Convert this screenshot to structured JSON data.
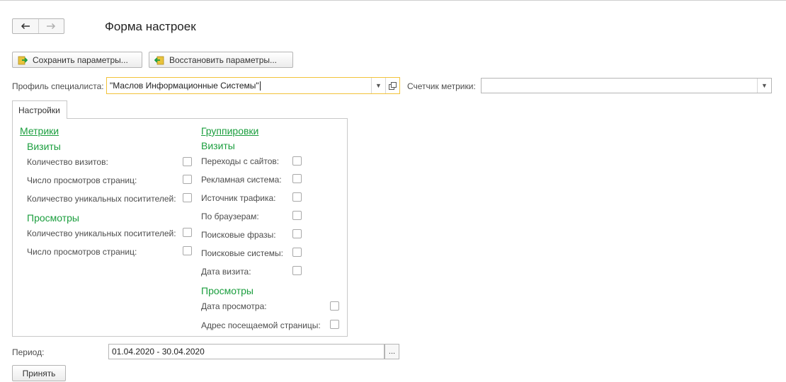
{
  "window": {
    "title": "Форма настроек"
  },
  "nav": {
    "back_icon": "arrow-left-icon",
    "forward_icon": "arrow-right-icon"
  },
  "toolbar": {
    "save_label": "Сохранить параметры...",
    "restore_label": "Восстановить параметры..."
  },
  "profile": {
    "label": "Профиль специалиста:",
    "value": "\"Маслов Информационные Системы\""
  },
  "counter": {
    "label": "Счетчик метрики:",
    "value": ""
  },
  "tabs": {
    "settings_label": "Настройки"
  },
  "metrics": {
    "title": "Метрики",
    "visits": {
      "header": "Визиты",
      "items": [
        {
          "label": "Количество визитов:",
          "checked": false
        },
        {
          "label": "Число просмотров страниц:",
          "checked": false
        },
        {
          "label": "Количество уникальных поситителей:",
          "checked": false
        }
      ]
    },
    "views": {
      "header": "Просмотры",
      "items": [
        {
          "label": "Количество уникальных поситителей:",
          "checked": false
        },
        {
          "label": "Число просмотров страниц:",
          "checked": false
        }
      ]
    }
  },
  "groupings": {
    "title": "Группировки",
    "visits": {
      "header": "Визиты",
      "items": [
        {
          "label": "Переходы с сайтов:",
          "checked": false
        },
        {
          "label": "Рекламная система:",
          "checked": false
        },
        {
          "label": "Источник трафика:",
          "checked": false
        },
        {
          "label": "По браузерам:",
          "checked": false
        },
        {
          "label": "Поисковые фразы:",
          "checked": false
        },
        {
          "label": "Поисковые системы:",
          "checked": false
        },
        {
          "label": "Дата визита:",
          "checked": false
        }
      ]
    },
    "views": {
      "header": "Просмотры",
      "items": [
        {
          "label": "Дата просмотра:",
          "checked": false
        },
        {
          "label": "Адрес посещаемой страницы:",
          "checked": false
        }
      ]
    }
  },
  "period": {
    "label": "Период:",
    "value": "01.04.2020 - 30.04.2020",
    "picker_label": "..."
  },
  "footer": {
    "accept_label": "Принять"
  },
  "colors": {
    "accent": "#1b9e3e",
    "focus": "#f2c33a"
  }
}
